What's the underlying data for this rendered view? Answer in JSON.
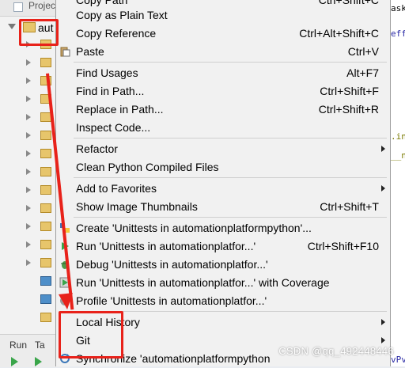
{
  "project_panel": {
    "header_label": "Projec",
    "root_label": "aut",
    "bottom_tabs": [
      "Run",
      "Ta"
    ]
  },
  "editor_fragments": [
    "askU",
    "eff.",
    ".in",
    "__n",
    "vPvt"
  ],
  "context_menu": {
    "items": [
      {
        "label": "Copy Path",
        "shortcut": "Ctrl+Shift+C",
        "icon": null,
        "submenu": false
      },
      {
        "label": "Copy as Plain Text",
        "shortcut": "",
        "icon": null,
        "submenu": false
      },
      {
        "label": "Copy Reference",
        "shortcut": "Ctrl+Alt+Shift+C",
        "icon": null,
        "submenu": false
      },
      {
        "label": "Paste",
        "shortcut": "Ctrl+V",
        "icon": "paste-icon",
        "submenu": false
      },
      {
        "label": "Find Usages",
        "shortcut": "Alt+F7",
        "icon": null,
        "submenu": false
      },
      {
        "label": "Find in Path...",
        "shortcut": "Ctrl+Shift+F",
        "icon": null,
        "submenu": false
      },
      {
        "label": "Replace in Path...",
        "shortcut": "Ctrl+Shift+R",
        "icon": null,
        "submenu": false
      },
      {
        "label": "Inspect Code...",
        "shortcut": "",
        "icon": null,
        "submenu": false
      },
      {
        "label": "Refactor",
        "shortcut": "",
        "icon": null,
        "submenu": true
      },
      {
        "label": "Clean Python Compiled Files",
        "shortcut": "",
        "icon": null,
        "submenu": false
      },
      {
        "label": "Add to Favorites",
        "shortcut": "",
        "icon": null,
        "submenu": true
      },
      {
        "label": "Show Image Thumbnails",
        "shortcut": "Ctrl+Shift+T",
        "icon": null,
        "submenu": false
      },
      {
        "label": "Create 'Unittests in automationplatformpython'...",
        "shortcut": "",
        "icon": "python-run-config-icon",
        "submenu": false
      },
      {
        "label": "Run 'Unittests in automationplatfor...'",
        "shortcut": "Ctrl+Shift+F10",
        "icon": "run-icon",
        "submenu": false
      },
      {
        "label": "Debug 'Unittests in automationplatfor...'",
        "shortcut": "",
        "icon": "debug-icon",
        "submenu": false
      },
      {
        "label": "Run 'Unittests in automationplatfor...' with Coverage",
        "shortcut": "",
        "icon": "coverage-icon",
        "submenu": false
      },
      {
        "label": "Profile 'Unittests in automationplatfor...'",
        "shortcut": "",
        "icon": "profile-icon",
        "submenu": false
      },
      {
        "label": "Local History",
        "shortcut": "",
        "icon": null,
        "submenu": true
      },
      {
        "label": "Git",
        "shortcut": "",
        "icon": null,
        "submenu": true
      },
      {
        "label": "Synchronize 'automationplatformpython",
        "shortcut": "",
        "icon": "sync-icon",
        "submenu": false
      }
    ]
  },
  "watermark": "CSDN @qq_492448446",
  "colors": {
    "highlight": "#e8221a",
    "menu_bg": "#f1f1f1",
    "folder": "#e7c56b"
  }
}
